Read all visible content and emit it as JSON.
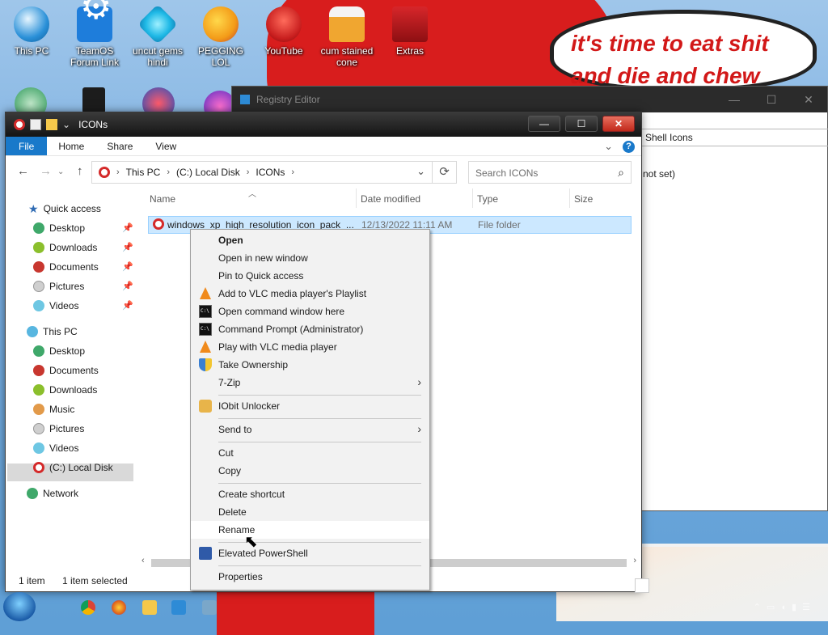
{
  "desktop": {
    "speech_bubble": "it's time to eat shit and die and chew",
    "icons": [
      {
        "label": "This PC"
      },
      {
        "label": "TeamOS Forum Link"
      },
      {
        "label": "uncut gems hindi"
      },
      {
        "label": "PEGGING LOL"
      },
      {
        "label": "YouTube"
      },
      {
        "label": "cum stained cone"
      },
      {
        "label": "Extras"
      }
    ]
  },
  "registry_editor": {
    "title": "Registry Editor",
    "address": "Shell Icons",
    "value": "(value not set)",
    "value_visible": "not set)"
  },
  "explorer": {
    "title": "ICONs",
    "ribbon": {
      "file": "File",
      "home": "Home",
      "share": "Share",
      "view": "View"
    },
    "breadcrumb": [
      "This PC",
      "(C:) Local Disk",
      "ICONs"
    ],
    "search_placeholder": "Search ICONs",
    "nav": {
      "quick_access": "Quick access",
      "quick_items": [
        "Desktop",
        "Downloads",
        "Documents",
        "Pictures",
        "Videos"
      ],
      "this_pc": "This PC",
      "pc_items": [
        "Desktop",
        "Documents",
        "Downloads",
        "Music",
        "Pictures",
        "Videos",
        "(C:) Local Disk"
      ],
      "network": "Network"
    },
    "columns": {
      "name": "Name",
      "date": "Date modified",
      "type": "Type",
      "size": "Size"
    },
    "files": [
      {
        "name": "windows_xp_high_resolution_icon_pack_...",
        "date": "12/13/2022 11:11 AM",
        "type": "File folder"
      }
    ],
    "status": {
      "count": "1 item",
      "selected": "1 item selected"
    }
  },
  "context_menu": {
    "items": [
      "Open",
      "Open in new window",
      "Pin to Quick access",
      "Add to VLC media player's Playlist",
      "Open command window here",
      "Command Prompt (Administrator)",
      "Play with VLC media player",
      "Take Ownership",
      "7-Zip",
      "IObit Unlocker",
      "Send to",
      "Cut",
      "Copy",
      "Create shortcut",
      "Delete",
      "Rename",
      "Elevated PowerShell",
      "Properties"
    ],
    "hovered": "Rename"
  },
  "icons": {
    "back": "←",
    "forward": "→",
    "up": "↑",
    "refresh": "⟳",
    "search": "⌕",
    "chevron_down": "⌄",
    "submenu": "›",
    "help": "?"
  },
  "colors": {
    "accent": "#1979ca",
    "selection": "#cce8ff",
    "close_red": "#c1281a"
  }
}
